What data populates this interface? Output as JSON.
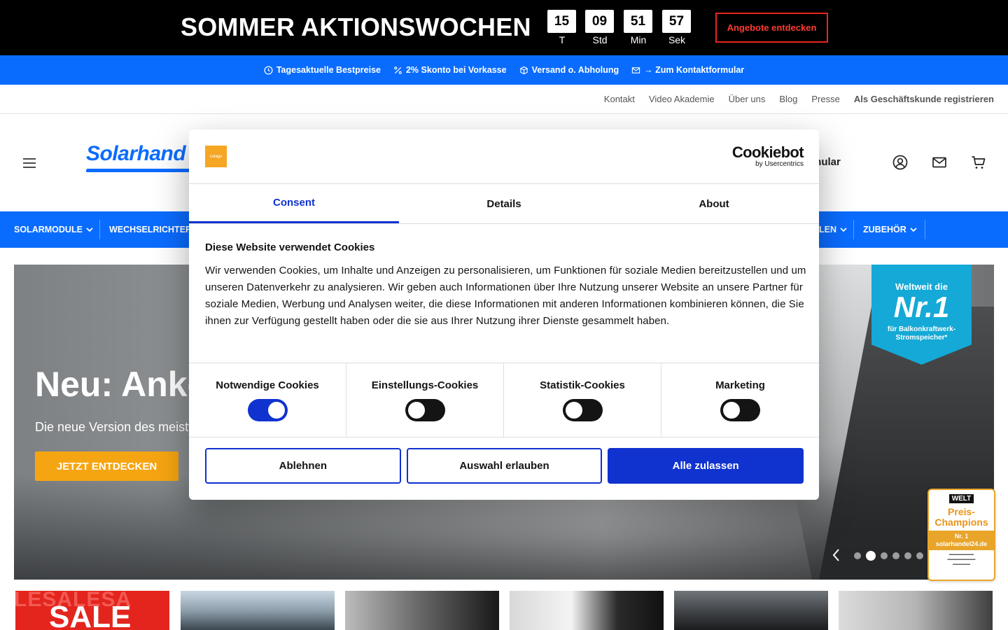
{
  "promo": {
    "title": "SOMMER AKTIONSWOCHEN",
    "countdown": [
      {
        "value": "15",
        "label": "T"
      },
      {
        "value": "09",
        "label": "Std"
      },
      {
        "value": "51",
        "label": "Min"
      },
      {
        "value": "57",
        "label": "Sek"
      }
    ],
    "button": "Angebote entdecken"
  },
  "usp": [
    {
      "icon": "clock-icon",
      "label": "Tagesaktuelle Bestpreise"
    },
    {
      "icon": "percent-icon",
      "label": "2% Skonto bei Vorkasse"
    },
    {
      "icon": "box-icon",
      "label": "Versand o. Abholung"
    },
    {
      "icon": "mail-icon",
      "label": "→ Zum Kontaktformular"
    }
  ],
  "toplinks": [
    "Kontakt",
    "Video Akademie",
    "Über uns",
    "Blog",
    "Presse",
    "Als Geschäftskunde registrieren"
  ],
  "header": {
    "logo": "Solarhand",
    "partial_text": "mular"
  },
  "categories": [
    "SOLARMODULE",
    "WECHSELRICHTER",
    "LEN",
    "ZUBEHÖR"
  ],
  "hero": {
    "title": "Neu: Anke",
    "subtitle": "Die neue Version des meistv",
    "button": "JETZT ENTDECKEN",
    "badge_line1": "Weltweit die",
    "badge_line2": "Nr.1",
    "badge_line3": "für Balkonkraftwerk-Stromspeicher*",
    "slide_index": 2,
    "slide_count": 6
  },
  "welt_badge": {
    "brand": "WELT",
    "title": "Preis-Champions",
    "rank": "Nr. 1 solarhandel24.de"
  },
  "tiles": {
    "sale_bg": "LESALESA",
    "sale_fg": "SALE"
  },
  "cookie": {
    "logo_text": "solago",
    "cookiebot_name": "Cookiebot",
    "cookiebot_by": "by Usercentrics",
    "tabs": [
      "Consent",
      "Details",
      "About"
    ],
    "heading": "Diese Website verwendet Cookies",
    "body": "Wir verwenden Cookies, um Inhalte und Anzeigen zu personalisieren, um Funktionen für soziale Medien bereitzustellen und um unseren Datenverkehr zu analysieren. Wir geben auch Informationen über Ihre Nutzung unserer Website an unsere Partner für soziale Medien, Werbung und Analysen weiter, die diese Informationen mit anderen Informationen kombinieren können, die Sie ihnen zur Verfügung gestellt haben oder die sie aus Ihrer Nutzung ihrer Dienste gesammelt haben.",
    "toggles": [
      {
        "label": "Notwendige Cookies",
        "on": true
      },
      {
        "label": "Einstellungs-Cookies",
        "on": false
      },
      {
        "label": "Statistik-Cookies",
        "on": false
      },
      {
        "label": "Marketing",
        "on": false
      }
    ],
    "buttons": {
      "reject": "Ablehnen",
      "allow_selection": "Auswahl erlauben",
      "allow_all": "Alle zulassen"
    }
  },
  "colors": {
    "brand_blue": "#0a6cff",
    "cookie_blue": "#1032cf",
    "cta_orange": "#f6a512",
    "promo_red": "#e5261f"
  }
}
